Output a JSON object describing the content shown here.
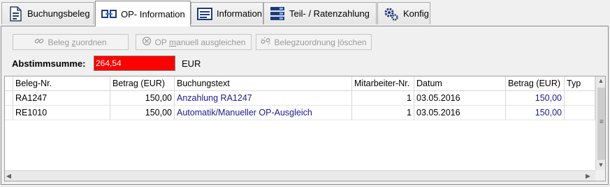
{
  "tabs": [
    {
      "label": "Buchungsbeleg",
      "icon": "document-icon",
      "active": false
    },
    {
      "label": "OP- Information",
      "icon": "link-icon",
      "active": true
    },
    {
      "label": "Information",
      "icon": "info-list-icon",
      "active": false
    },
    {
      "label": "Teil- / Ratenzahlung",
      "icon": "server-icon",
      "active": false
    },
    {
      "label": "Konfig",
      "icon": "gears-icon",
      "active": false
    }
  ],
  "toolbar": {
    "assign_prefix": "Beleg ",
    "assign_ul": "z",
    "assign_suffix": "uordnen",
    "manual_prefix": "OP ",
    "manual_ul": "m",
    "manual_suffix": "anuell ausgleichen",
    "delete_prefix": "Belegzuordnung ",
    "delete_ul": "l",
    "delete_suffix": "öschen"
  },
  "summary": {
    "label": "Abstimmsumme:",
    "value": "264,54",
    "unit": "EUR",
    "alert_color": "#ff0000"
  },
  "table": {
    "columns": [
      "Beleg-Nr.",
      "Betrag (EUR)",
      "Buchungstext",
      "Mitarbeiter-Nr.",
      "Datum",
      "Betrag (EUR)",
      "Typ"
    ],
    "rows": [
      [
        "RA1247",
        "150,00",
        "Anzahlung RA1247",
        "1",
        "03.05.2016",
        "150,00",
        ""
      ],
      [
        "RE1010",
        "150,00",
        "Automatik/Manueller OP-Ausgleich",
        "1",
        "03.05.2016",
        "150,00",
        ""
      ]
    ]
  }
}
